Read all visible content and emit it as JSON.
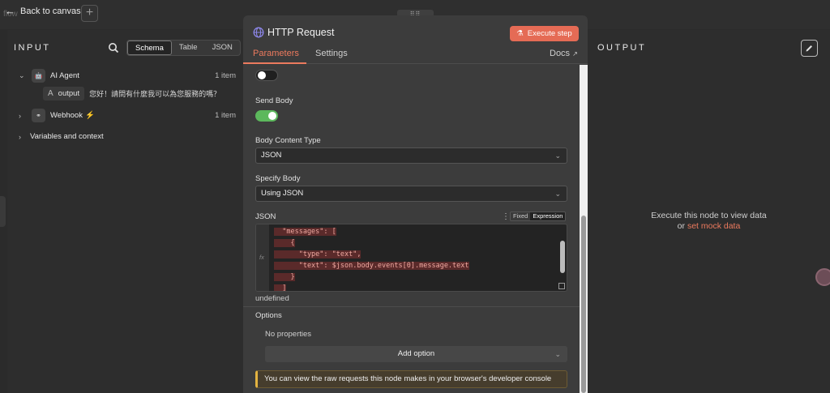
{
  "topbar": {
    "back_label": "Back to canvas",
    "ghost_label": "flow",
    "plus_label": "+"
  },
  "input_panel": {
    "title": "INPUT",
    "view_toggle": [
      "Schema",
      "Table",
      "JSON"
    ],
    "active_view": "Schema",
    "tree": [
      {
        "label": "AI Agent",
        "count": "1 item",
        "expanded": true,
        "icon": "robot-icon"
      },
      {
        "label": "Webhook",
        "count": "1 item",
        "expanded": false,
        "icon": "webhook-icon",
        "badge": "⚡"
      },
      {
        "label": "Variables and context",
        "expanded": false
      }
    ],
    "output_field": {
      "type_symbol": "A",
      "name": "output",
      "value": "您好！請問有什麼我可以為您服務的嗎？"
    }
  },
  "dialog": {
    "title": "HTTP Request",
    "execute_label": "Execute step",
    "tabs": [
      "Parameters",
      "Settings"
    ],
    "docs_label": "Docs",
    "send_body_label": "Send Body",
    "body_content_type_label": "Body Content Type",
    "body_content_type_value": "JSON",
    "specify_body_label": "Specify Body",
    "specify_body_value": "Using JSON",
    "json_label": "JSON",
    "json_modes": [
      "Fixed",
      "Expression"
    ],
    "json_active_mode": "Expression",
    "fx_label": "fx",
    "code_lines": [
      "  \"messages\": [",
      "    {",
      "      \"type\": \"text\",",
      "      \"text\": $json.body.events[0].message.text",
      "    }",
      "  ]"
    ],
    "undefined_text": "undefined",
    "options_label": "Options",
    "no_properties": "No properties",
    "add_option_label": "Add option",
    "notice": "You can view the raw requests this node makes in your browser's developer console"
  },
  "output_panel": {
    "title": "OUTPUT",
    "message_line1": "Execute this node to view data",
    "message_or": "or",
    "mock_link": "set mock data"
  },
  "colors": {
    "accent": "#e56b55",
    "toggle_on": "#5cb85c",
    "toggle_off": "#1f1f1f"
  }
}
